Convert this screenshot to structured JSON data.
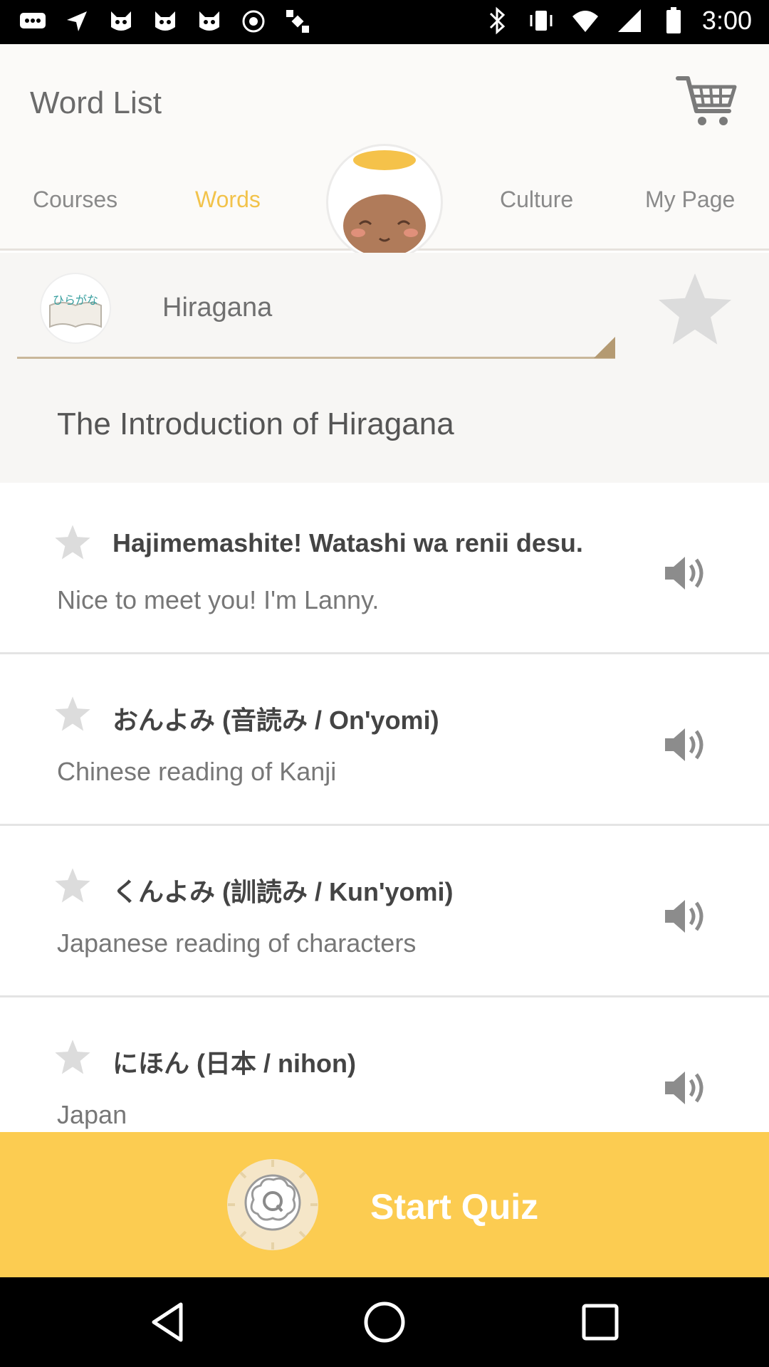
{
  "status_bar": {
    "time": "3:00",
    "left_icons": [
      "chat-icon",
      "location-icon",
      "cat-icon",
      "cat-icon",
      "cat-icon",
      "location-dot-icon",
      "satellite-icon"
    ],
    "right_icons": [
      "bluetooth-icon",
      "vibrate-icon",
      "wifi-icon",
      "signal-icon",
      "battery-icon"
    ]
  },
  "header": {
    "title": "Word List",
    "cart_icon": "cart-icon",
    "tabs": [
      {
        "label": "Courses",
        "active": false
      },
      {
        "label": "Words",
        "active": true
      },
      {
        "label": "Culture",
        "active": false
      },
      {
        "label": "My Page",
        "active": false
      }
    ],
    "mascot_icon": "mascot-face-icon"
  },
  "category": {
    "badge_text": "ひらがな",
    "name": "Hiragana",
    "section_title": "The Introduction of Hiragana",
    "favorite_icon": "star-icon"
  },
  "items": [
    {
      "title": "Hajimemashite! Watashi wa renii desu.",
      "subtitle": "Nice to meet you! I'm Lanny."
    },
    {
      "title": "おんよみ (音読み / On'yomi)",
      "subtitle": "Chinese reading of Kanji"
    },
    {
      "title": "くんよみ (訓読み / Kun'yomi)",
      "subtitle": "Japanese reading of characters"
    },
    {
      "title": "にほん (日本 / nihon)",
      "subtitle": "Japan"
    }
  ],
  "quiz": {
    "label": "Start Quiz",
    "icon": "quiz-brain-icon"
  },
  "colors": {
    "accent": "#f2c34b",
    "quiz_bar": "#fccc51",
    "star_grey": "#d9d9d9",
    "sound_grey": "#8c8c8c"
  }
}
